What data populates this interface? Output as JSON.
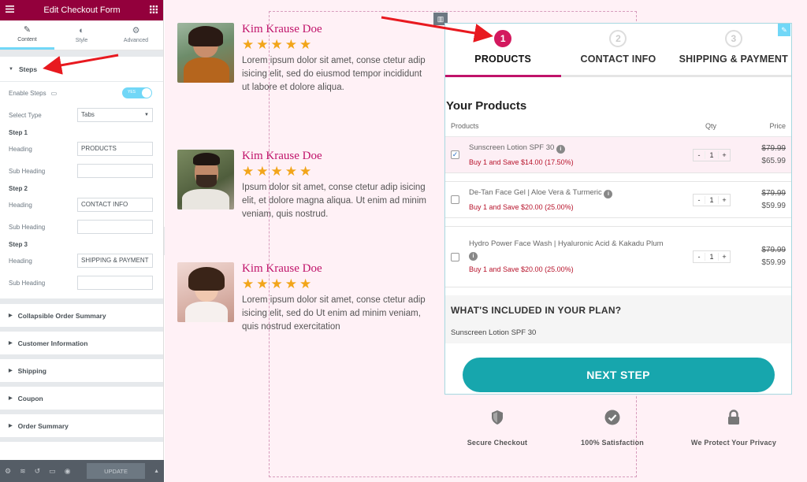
{
  "editor": {
    "title": "Edit Checkout Form",
    "tabs": [
      {
        "label": "Content",
        "icon": "pencil-icon"
      },
      {
        "label": "Style",
        "icon": "half-circle-icon"
      },
      {
        "label": "Advanced",
        "icon": "gear-icon"
      }
    ],
    "steps_section": {
      "label": "Steps",
      "enable_steps_label": "Enable Steps",
      "toggle_text": "YES",
      "select_type_label": "Select Type",
      "select_type_value": "Tabs",
      "heading_label": "Heading",
      "sub_heading_label": "Sub Heading",
      "steps": [
        {
          "label": "Step 1",
          "heading": "PRODUCTS",
          "sub_heading": ""
        },
        {
          "label": "Step 2",
          "heading": "CONTACT INFO",
          "sub_heading": ""
        },
        {
          "label": "Step 3",
          "heading": "SHIPPING & PAYMENT",
          "sub_heading": ""
        }
      ]
    },
    "collapsed_sections": [
      "Collapsible Order Summary",
      "Customer Information",
      "Shipping",
      "Coupon",
      "Order Summary"
    ],
    "footer": {
      "update_label": "UPDATE"
    }
  },
  "testimonials": [
    {
      "name": "Kim Krause Doe",
      "stars": "★★★★★",
      "rating": 5,
      "text": "Lorem ipsum dolor sit amet, conse ctetur adip isicing elit, sed do eiusmod tempor incididunt ut labore et dolore aliqua."
    },
    {
      "name": "Kim Krause Doe",
      "stars": "★★★★★",
      "rating": 5,
      "text": "Ipsum dolor sit amet, conse ctetur adip isicing elit, et dolore magna aliqua. Ut enim ad minim veniam, quis nostrud."
    },
    {
      "name": "Kim Krause Doe",
      "stars": "★★★★★",
      "rating": 5,
      "text": "Lorem ipsum dolor sit amet, conse ctetur adip isicing elit, sed do Ut enim ad minim veniam, quis nostrud exercitation"
    }
  ],
  "checkout": {
    "steps": [
      {
        "number": "1",
        "title": "PRODUCTS"
      },
      {
        "number": "2",
        "title": "CONTACT INFO"
      },
      {
        "number": "3",
        "title": "SHIPPING & PAYMENT"
      }
    ],
    "your_products": "Your Products",
    "columns": {
      "product": "Products",
      "qty": "Qty",
      "price": "Price"
    },
    "products": [
      {
        "name": "Sunscreen Lotion SPF 30",
        "deal": "Buy 1 and Save $14.00 (17.50%)",
        "qty": "1",
        "old_price": "$79.99",
        "price": "$65.99",
        "checked": true
      },
      {
        "name": "De-Tan Face Gel | Aloe Vera & Turmeric",
        "deal": "Buy 1 and Save $20.00 (25.00%)",
        "qty": "1",
        "old_price": "$79.99",
        "price": "$59.99",
        "checked": false
      },
      {
        "name": "Hydro Power Face Wash | Hyaluronic Acid & Kakadu Plum",
        "deal": "Buy 1 and Save $20.00 (25.00%)",
        "qty": "1",
        "old_price": "$79.99",
        "price": "$59.99",
        "checked": false
      }
    ],
    "plan_heading": "WHAT'S INCLUDED IN YOUR PLAN?",
    "plan_item": "Sunscreen Lotion SPF 30",
    "next_button": "NEXT STEP",
    "trust": [
      {
        "label": "Secure Checkout",
        "icon": "shield-icon"
      },
      {
        "label": "100% Satisfaction",
        "icon": "check-circle-icon"
      },
      {
        "label": "We Protect Your Privacy",
        "icon": "lock-icon"
      }
    ],
    "qty_minus": "-",
    "qty_plus": "+"
  },
  "colors": {
    "editor_header": "#93003c",
    "accent": "#c0136a",
    "next_button": "#17a6ad",
    "stars": "#f2a51a",
    "annotation_arrow": "#e8191f"
  }
}
